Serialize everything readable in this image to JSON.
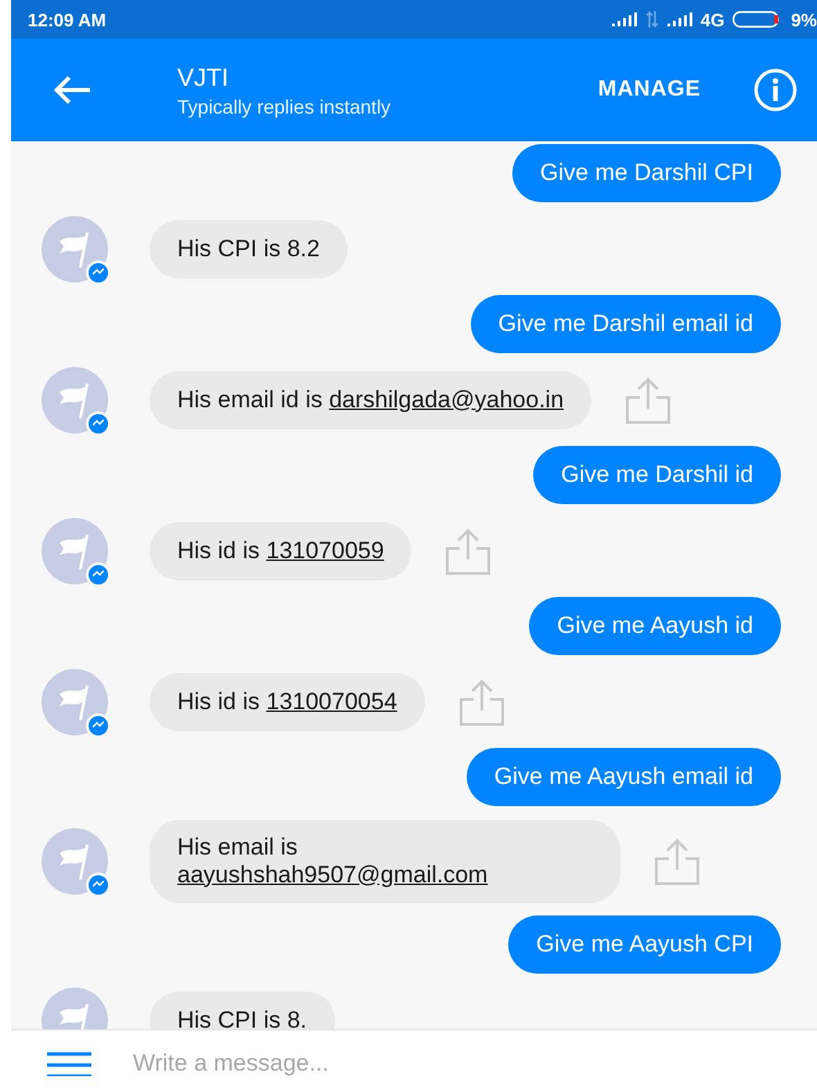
{
  "status_bar": {
    "time": "12:09 AM",
    "network": "4G",
    "battery": "9%"
  },
  "header": {
    "title": "VJTI",
    "subtitle": "Typically replies instantly",
    "action": "MANAGE"
  },
  "messages": [
    {
      "kind": "outgoing",
      "text": "Give me Darshil CPI"
    },
    {
      "kind": "incoming",
      "text": "His CPI is 8.2",
      "share_button": false
    },
    {
      "kind": "outgoing",
      "text": "Give me Darshil email id"
    },
    {
      "kind": "incoming",
      "text": "His email id is ",
      "link": "darshilgada@yahoo.in",
      "share_button": true
    },
    {
      "kind": "outgoing",
      "text": "Give me Darshil id"
    },
    {
      "kind": "incoming",
      "text": "His id is ",
      "link": "131070059",
      "share_button": true
    },
    {
      "kind": "outgoing",
      "text": "Give me Aayush id"
    },
    {
      "kind": "incoming",
      "text": "His id is ",
      "link": "1310070054",
      "share_button": true
    },
    {
      "kind": "outgoing",
      "text": "Give me Aayush email id"
    },
    {
      "kind": "incoming",
      "text": "His email is ",
      "link": "aayushshah9507@gmail.com",
      "share_button": true
    },
    {
      "kind": "outgoing",
      "text": "Give me Aayush CPI"
    },
    {
      "kind": "incoming",
      "text": "His CPI is 8.",
      "share_button": false
    }
  ],
  "composer": {
    "placeholder": "Write a message..."
  }
}
